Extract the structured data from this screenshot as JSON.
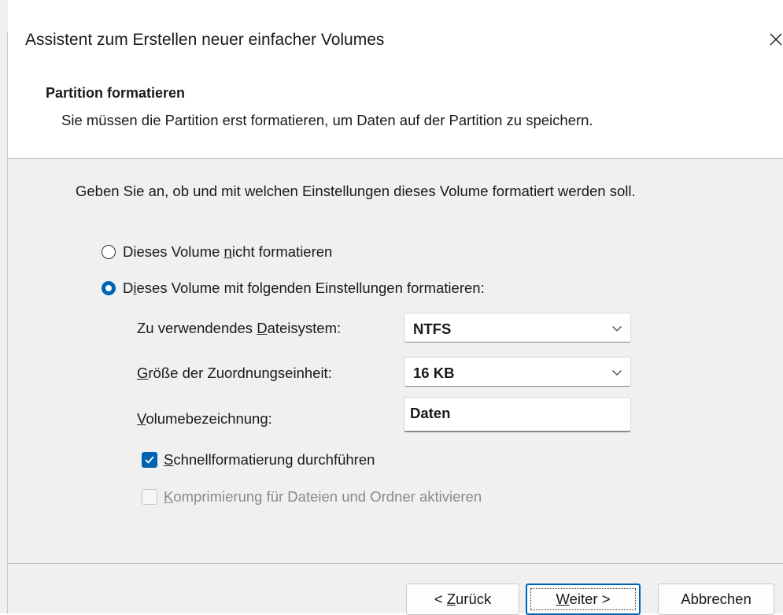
{
  "window": {
    "title": "Assistent zum Erstellen neuer einfacher Volumes"
  },
  "header": {
    "title": "Partition formatieren",
    "subtitle": "Sie müssen die Partition erst formatieren, um Daten auf der Partition zu speichern."
  },
  "content": {
    "instruction": "Geben Sie an, ob und mit welchen Einstellungen dieses Volume formatiert werden soll.",
    "radio_no_format": {
      "pre": "Dieses Volume ",
      "accel": "n",
      "post": "icht formatieren",
      "selected": false
    },
    "radio_format": {
      "pre": "D",
      "accel": "i",
      "post": "eses Volume mit folgenden Einstellungen formatieren:",
      "selected": true
    },
    "filesystem": {
      "label_pre": "Zu verwendendes ",
      "label_accel": "D",
      "label_post": "ateisystem:",
      "value": "NTFS"
    },
    "allocation": {
      "label_pre": "",
      "label_accel": "G",
      "label_post": "röße der Zuordnungseinheit:",
      "value": "16 KB"
    },
    "volume_label": {
      "label_pre": "",
      "label_accel": "V",
      "label_post": "olumebezeichnung:",
      "value": "Daten"
    },
    "quick_format": {
      "accel": "S",
      "post": "chnellformatierung durchführen",
      "checked": true
    },
    "compression": {
      "accel": "K",
      "post": "omprimierung für Dateien und Ordner aktivieren",
      "checked": false,
      "enabled": false
    }
  },
  "buttons": {
    "back": {
      "pre": "< ",
      "accel": "Z",
      "post": "urück"
    },
    "next": {
      "accel": "W",
      "post": "eiter >"
    },
    "cancel": {
      "label": "Abbrechen"
    }
  },
  "colors": {
    "accent": "#0063b1",
    "disabled_text": "#8a8a8a"
  },
  "icons": {
    "close": "close-icon",
    "dropdown": "chevron-down-icon",
    "check": "checkmark-icon"
  }
}
